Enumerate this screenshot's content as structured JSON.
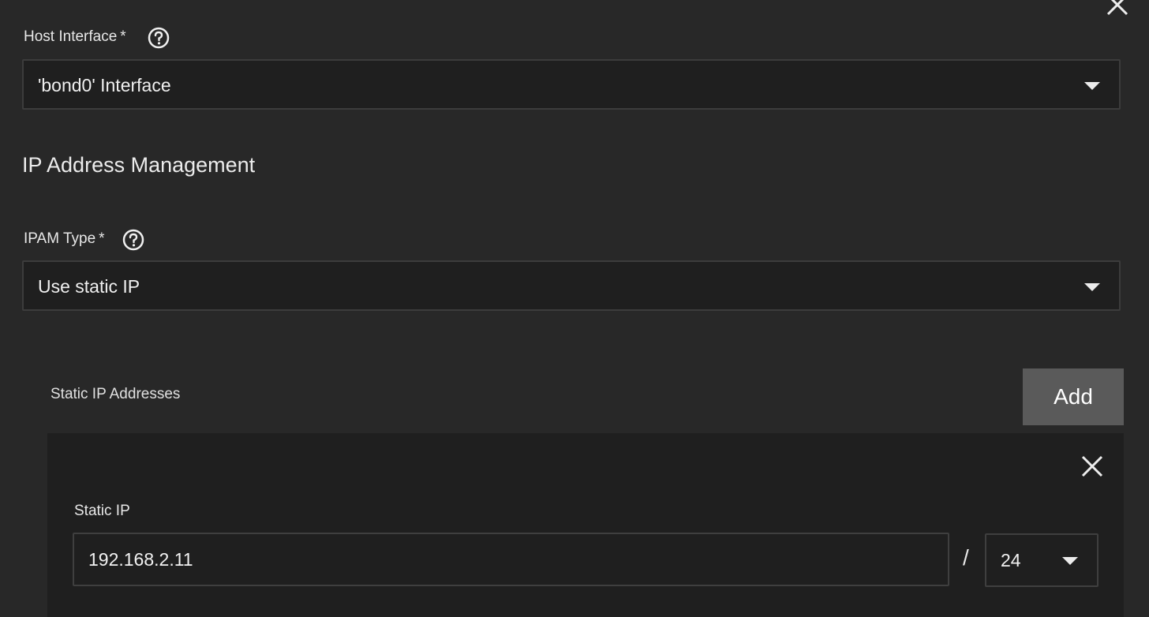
{
  "host_interface": {
    "label": "Host Interface",
    "required_mark": "*",
    "value": "'bond0' Interface"
  },
  "ipam_section": {
    "title": "IP Address Management"
  },
  "ipam_type": {
    "label": "IPAM Type",
    "required_mark": "*",
    "value": "Use static IP"
  },
  "static_ips": {
    "label": "Static IP Addresses",
    "add_label": "Add",
    "items": [
      {
        "label": "Static IP",
        "address": "192.168.2.11",
        "separator": "/",
        "netmask": "24"
      }
    ]
  },
  "icons": {
    "close": "close-icon",
    "help": "help-circle-icon",
    "dropdown": "caret-down-icon"
  },
  "colors": {
    "background": "#282828",
    "field_background": "#1f1f1f",
    "border": "#3c3c3c",
    "button": "#5a5a5a",
    "text": "#e6e6e6"
  }
}
